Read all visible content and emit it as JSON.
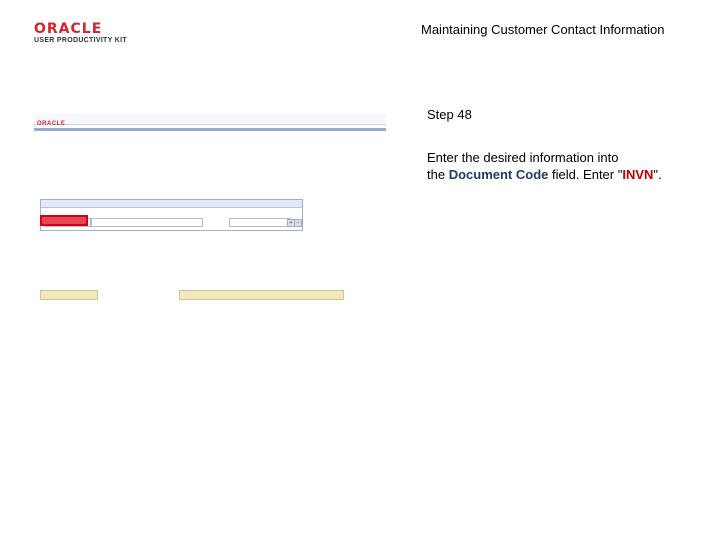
{
  "logo": {
    "brand": "ORACLE",
    "tagline": "USER PRODUCTIVITY KIT"
  },
  "header": {
    "title": "Maintaining Customer Contact Information"
  },
  "step": {
    "label": "Step 48"
  },
  "instruction": {
    "line1": "Enter the desired information into",
    "line2_pre": "the ",
    "field": "Document Code",
    "line2_mid": " field. Enter \"",
    "value": "INVN",
    "line2_end": "\"."
  },
  "screenshot": {
    "mini_logo": "ORACLE"
  }
}
